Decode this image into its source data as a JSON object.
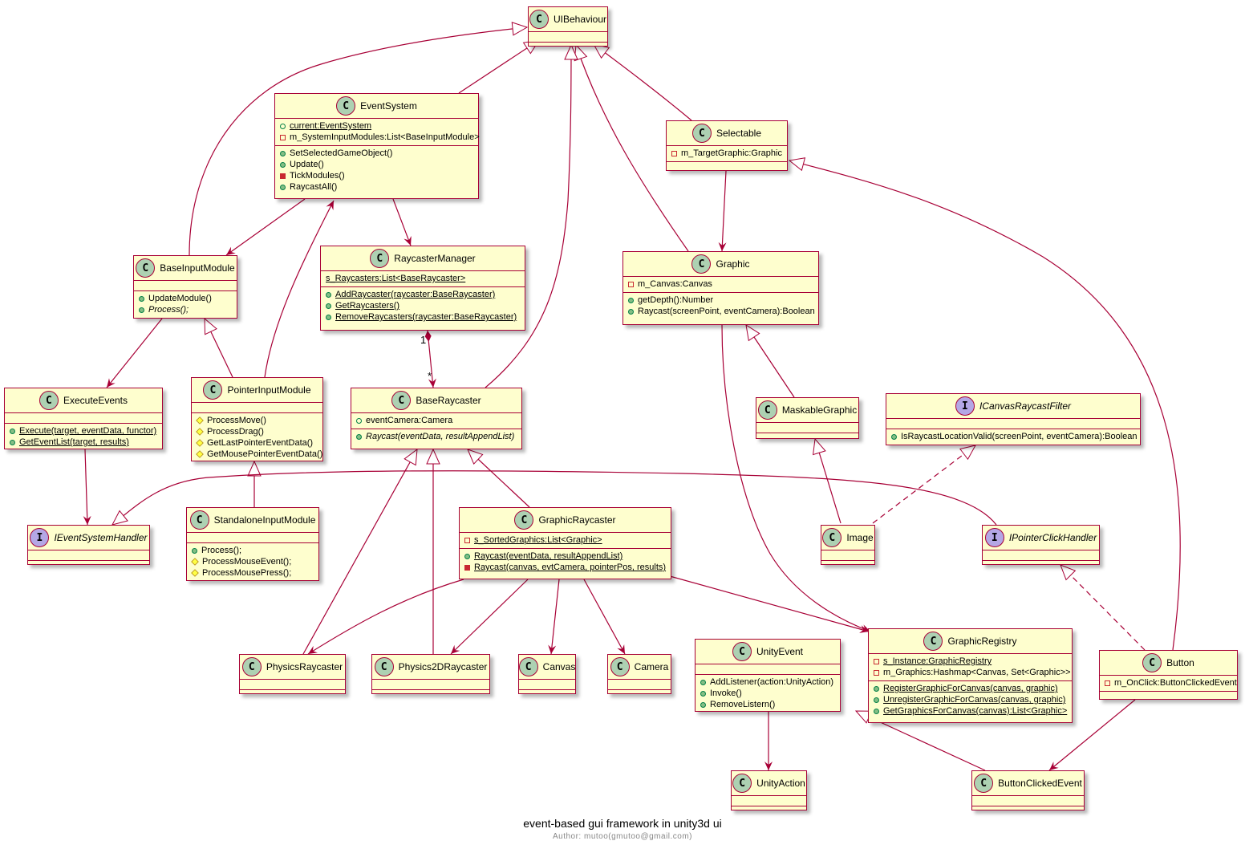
{
  "diagram": {
    "title": "event-based gui framework in unity3d ui",
    "author": "Author: mutoo(gmutoo@gmail.com)",
    "colors": {
      "border": "#A80036",
      "fill": "#FEFECE",
      "class_badge": "#ADD1B2",
      "interface_badge": "#B4A7E5"
    }
  },
  "classes": {
    "UIBehaviour": {
      "kind": "C",
      "name": "UIBehaviour",
      "fields": [],
      "methods": []
    },
    "EventSystem": {
      "kind": "C",
      "name": "EventSystem",
      "fields": [
        {
          "vis": "pub-f",
          "text": "current:EventSystem",
          "u": true
        },
        {
          "vis": "priv-f",
          "text": "m_SystemInputModules:List<BaseInputModule>"
        }
      ],
      "methods": [
        {
          "vis": "pub-m",
          "text": "SetSelectedGameObject()"
        },
        {
          "vis": "pub-m",
          "text": "Update()"
        },
        {
          "vis": "priv-m",
          "text": "TickModules()"
        },
        {
          "vis": "pub-m",
          "text": "RaycastAll()"
        }
      ]
    },
    "Selectable": {
      "kind": "C",
      "name": "Selectable",
      "fields": [
        {
          "vis": "priv-f",
          "text": "m_TargetGraphic:Graphic"
        }
      ],
      "methods": []
    },
    "BaseInputModule": {
      "kind": "C",
      "name": "BaseInputModule",
      "fields": [],
      "methods": [
        {
          "vis": "pub-m",
          "text": "UpdateModule()"
        },
        {
          "vis": "pub-m",
          "text": "Process();",
          "i": true
        }
      ]
    },
    "RaycasterManager": {
      "kind": "C",
      "name": "RaycasterManager",
      "fields": [
        {
          "vis": "",
          "text": "s_Raycasters:List<BaseRaycaster>",
          "u": true
        }
      ],
      "methods": [
        {
          "vis": "pub-m",
          "text": "AddRaycaster(raycaster:BaseRaycaster)",
          "u": true
        },
        {
          "vis": "pub-m",
          "text": "GetRaycasters()",
          "u": true
        },
        {
          "vis": "pub-m",
          "text": "RemoveRaycasters(raycaster:BaseRaycaster)",
          "u": true
        }
      ]
    },
    "Graphic": {
      "kind": "C",
      "name": "Graphic",
      "fields": [
        {
          "vis": "priv-f",
          "text": "m_Canvas:Canvas"
        }
      ],
      "methods": [
        {
          "vis": "pub-m",
          "text": "getDepth():Number"
        },
        {
          "vis": "pub-m",
          "text": "Raycast(screenPoint, eventCamera):Boolean"
        }
      ]
    },
    "ExecuteEvents": {
      "kind": "C",
      "name": "ExecuteEvents",
      "fields": [],
      "methods": [
        {
          "vis": "pub-m",
          "text": "Execute(target, eventData, functor)",
          "u": true
        },
        {
          "vis": "pub-m",
          "text": "GetEventList(target, results)",
          "u": true
        }
      ]
    },
    "PointerInputModule": {
      "kind": "C",
      "name": "PointerInputModule",
      "fields": [],
      "methods": [
        {
          "vis": "prot",
          "text": "ProcessMove()"
        },
        {
          "vis": "prot",
          "text": "ProcessDrag()"
        },
        {
          "vis": "prot",
          "text": "GetLastPointerEventData()"
        },
        {
          "vis": "prot",
          "text": "GetMousePointerEventData()"
        }
      ]
    },
    "BaseRaycaster": {
      "kind": "C",
      "name": "BaseRaycaster",
      "fields": [
        {
          "vis": "pub-f",
          "text": "eventCamera:Camera"
        }
      ],
      "methods": [
        {
          "vis": "pub-m",
          "text": "Raycast(eventData, resultAppendList)",
          "i": true
        }
      ]
    },
    "MaskableGraphic": {
      "kind": "C",
      "name": "MaskableGraphic",
      "fields": [],
      "methods": []
    },
    "ICanvasRaycastFilter": {
      "kind": "I",
      "name": "ICanvasRaycastFilter",
      "fields": [],
      "methods": [
        {
          "vis": "pub-m",
          "text": "IsRaycastLocationValid(screenPoint, eventCamera):Boolean"
        }
      ]
    },
    "IEventSystemHandler": {
      "kind": "I",
      "name": "IEventSystemHandler",
      "fields": [],
      "methods": []
    },
    "StandaloneInputModule": {
      "kind": "C",
      "name": "StandaloneInputModule",
      "fields": [],
      "methods": [
        {
          "vis": "pub-m",
          "text": "Process();"
        },
        {
          "vis": "prot",
          "text": "ProcessMouseEvent();"
        },
        {
          "vis": "prot",
          "text": "ProcessMousePress();"
        }
      ]
    },
    "GraphicRaycaster": {
      "kind": "C",
      "name": "GraphicRaycaster",
      "fields": [
        {
          "vis": "priv-f",
          "text": "s_SortedGraphics:List<Graphic>",
          "u": true
        }
      ],
      "methods": [
        {
          "vis": "pub-m",
          "text": "Raycast(eventData, resultAppendList)",
          "u": true
        },
        {
          "vis": "priv-m",
          "text": "Raycast(canvas, evtCamera, pointerPos, results)",
          "u": true
        }
      ]
    },
    "Image": {
      "kind": "C",
      "name": "Image",
      "fields": [],
      "methods": []
    },
    "IPointerClickHandler": {
      "kind": "I",
      "name": "IPointerClickHandler",
      "fields": [],
      "methods": []
    },
    "PhysicsRaycaster": {
      "kind": "C",
      "name": "PhysicsRaycaster",
      "fields": [],
      "methods": []
    },
    "Physics2DRaycaster": {
      "kind": "C",
      "name": "Physics2DRaycaster",
      "fields": [],
      "methods": []
    },
    "Canvas": {
      "kind": "C",
      "name": "Canvas",
      "fields": [],
      "methods": []
    },
    "Camera": {
      "kind": "C",
      "name": "Camera",
      "fields": [],
      "methods": []
    },
    "UnityEvent": {
      "kind": "C",
      "name": "UnityEvent",
      "fields": [],
      "methods": [
        {
          "vis": "pub-m",
          "text": "AddListener(action:UnityAction)"
        },
        {
          "vis": "pub-m",
          "text": "Invoke()"
        },
        {
          "vis": "pub-m",
          "text": "RemoveListern()"
        }
      ]
    },
    "GraphicRegistry": {
      "kind": "C",
      "name": "GraphicRegistry",
      "fields": [
        {
          "vis": "priv-f",
          "text": "s_Instance:GraphicRegistry",
          "u": true
        },
        {
          "vis": "priv-f",
          "text": "m_Graphics:Hashmap<Canvas, Set<Graphic>>"
        }
      ],
      "methods": [
        {
          "vis": "pub-m",
          "text": "RegisterGraphicForCanvas(canvas, graphic)",
          "u": true
        },
        {
          "vis": "pub-m",
          "text": "UnregisterGraphicForCanvas(canvas, graphic)",
          "u": true
        },
        {
          "vis": "pub-m",
          "text": "GetGraphicsForCanvas(canvas):List<Graphic>",
          "u": true
        }
      ]
    },
    "Button": {
      "kind": "C",
      "name": "Button",
      "fields": [
        {
          "vis": "priv-f",
          "text": "m_OnClick:ButtonClickedEvent"
        }
      ],
      "methods": []
    },
    "UnityAction": {
      "kind": "C",
      "name": "UnityAction",
      "fields": [],
      "methods": []
    },
    "ButtonClickedEvent": {
      "kind": "C",
      "name": "ButtonClickedEvent",
      "fields": [],
      "methods": []
    }
  },
  "relations": [
    {
      "from": "EventSystem",
      "to": "UIBehaviour",
      "type": "extends"
    },
    {
      "from": "BaseInputModule",
      "to": "UIBehaviour",
      "type": "extends"
    },
    {
      "from": "Selectable",
      "to": "UIBehaviour",
      "type": "extends"
    },
    {
      "from": "Graphic",
      "to": "UIBehaviour",
      "type": "extends"
    },
    {
      "from": "BaseRaycaster",
      "to": "UIBehaviour",
      "type": "extends"
    },
    {
      "from": "EventSystem",
      "to": "BaseInputModule",
      "type": "association"
    },
    {
      "from": "PointerInputModule",
      "to": "EventSystem",
      "type": "association"
    },
    {
      "from": "EventSystem",
      "to": "RaycasterManager",
      "type": "association"
    },
    {
      "from": "Selectable",
      "to": "Graphic",
      "type": "association"
    },
    {
      "from": "Button",
      "to": "Selectable",
      "type": "extends"
    },
    {
      "from": "RaycasterManager",
      "to": "BaseRaycaster",
      "type": "composition",
      "from_mult": "1",
      "to_mult": "*"
    },
    {
      "from": "BaseInputModule",
      "to": "ExecuteEvents",
      "type": "association"
    },
    {
      "from": "PointerInputModule",
      "to": "BaseInputModule",
      "type": "extends"
    },
    {
      "from": "ExecuteEvents",
      "to": "IEventSystemHandler",
      "type": "association"
    },
    {
      "from": "StandaloneInputModule",
      "to": "PointerInputModule",
      "type": "extends"
    },
    {
      "from": "IPointerClickHandler",
      "to": "IEventSystemHandler",
      "type": "extends"
    },
    {
      "from": "GraphicRaycaster",
      "to": "BaseRaycaster",
      "type": "extends"
    },
    {
      "from": "PhysicsRaycaster",
      "to": "BaseRaycaster",
      "type": "extends"
    },
    {
      "from": "Physics2DRaycaster",
      "to": "BaseRaycaster",
      "type": "extends"
    },
    {
      "from": "MaskableGraphic",
      "to": "Graphic",
      "type": "extends"
    },
    {
      "from": "Image",
      "to": "MaskableGraphic",
      "type": "extends"
    },
    {
      "from": "Image",
      "to": "ICanvasRaycastFilter",
      "type": "implements"
    },
    {
      "from": "Button",
      "to": "IPointerClickHandler",
      "type": "implements"
    },
    {
      "from": "Graphic",
      "to": "GraphicRegistry",
      "type": "association"
    },
    {
      "from": "GraphicRaycaster",
      "to": "PhysicsRaycaster",
      "type": "association"
    },
    {
      "from": "GraphicRaycaster",
      "to": "Physics2DRaycaster",
      "type": "association"
    },
    {
      "from": "GraphicRaycaster",
      "to": "Canvas",
      "type": "association"
    },
    {
      "from": "GraphicRaycaster",
      "to": "Camera",
      "type": "association"
    },
    {
      "from": "GraphicRaycaster",
      "to": "GraphicRegistry",
      "type": "association"
    },
    {
      "from": "UnityEvent",
      "to": "UnityAction",
      "type": "association"
    },
    {
      "from": "ButtonClickedEvent",
      "to": "UnityEvent",
      "type": "extends"
    },
    {
      "from": "Button",
      "to": "ButtonClickedEvent",
      "type": "association"
    }
  ]
}
